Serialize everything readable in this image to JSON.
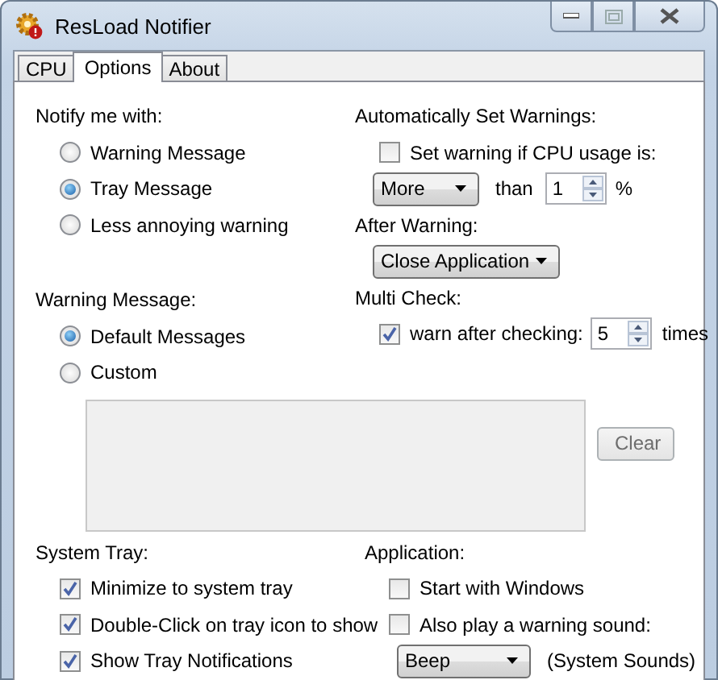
{
  "window": {
    "title": "ResLoad Notifier"
  },
  "tabs": [
    {
      "label": "CPU",
      "selected": false
    },
    {
      "label": "Options",
      "selected": true
    },
    {
      "label": "About",
      "selected": false
    }
  ],
  "notify": {
    "heading": "Notify me with:",
    "options": [
      {
        "label": "Warning Message",
        "selected": false
      },
      {
        "label": "Tray Message",
        "selected": true
      },
      {
        "label": "Less annoying warning",
        "selected": false
      }
    ]
  },
  "warning_message": {
    "heading": "Warning Message:",
    "options": [
      {
        "label": "Default Messages",
        "selected": true
      },
      {
        "label": "Custom",
        "selected": false
      }
    ],
    "clear_button": "Clear"
  },
  "auto_warnings": {
    "heading": "Automatically Set Warnings:",
    "checkbox": {
      "label": "Set warning if CPU usage is:",
      "checked": false
    },
    "comparison": "More",
    "than_label": "than",
    "threshold": "1",
    "unit": "%"
  },
  "after_warning": {
    "heading": "After Warning:",
    "action": "Close Application"
  },
  "multi_check": {
    "heading": "Multi Check:",
    "checkbox": {
      "label": "warn after checking:",
      "checked": true
    },
    "count": "5",
    "unit": "times"
  },
  "system_tray": {
    "heading": "System Tray:",
    "options": [
      {
        "label": "Minimize to system tray",
        "checked": true
      },
      {
        "label": "Double-Click on tray icon to show",
        "checked": true
      },
      {
        "label": "Show Tray Notifications",
        "checked": true
      }
    ]
  },
  "application": {
    "heading": "Application:",
    "options": [
      {
        "label": "Start with Windows",
        "checked": false
      },
      {
        "label": "Also play a warning sound:",
        "checked": false
      }
    ],
    "sound": "Beep",
    "sound_note": "(System Sounds)"
  }
}
